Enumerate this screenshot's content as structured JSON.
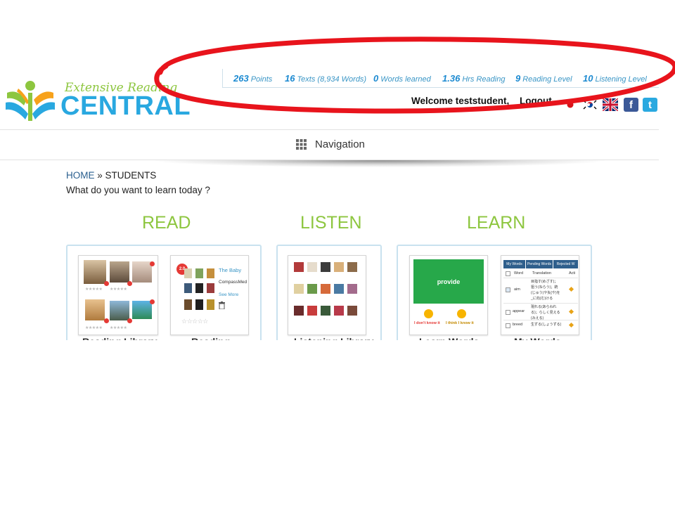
{
  "brand": {
    "script": "Extensive Reading",
    "name": "CENTRAL",
    "colors": {
      "green": "#8dc63f",
      "blue": "#29a8e0"
    }
  },
  "stats": [
    {
      "value": "263",
      "label": "Points"
    },
    {
      "value": "16",
      "label": "Texts (8,934 Words)"
    },
    {
      "value": "0",
      "label": "Words learned"
    },
    {
      "value": "1.36",
      "label": "Hrs Reading"
    },
    {
      "value": "9",
      "label": "Reading Level"
    },
    {
      "value": "10",
      "label": "Listening Level"
    }
  ],
  "user": {
    "welcome": "Welcome teststudent,",
    "logout": "Logout"
  },
  "language_flags": [
    "japan-flag-icon",
    "korea-flag-icon",
    "uk-flag-icon"
  ],
  "social": [
    {
      "icon": "facebook-icon",
      "glyph": "f",
      "color": "#3b5998"
    },
    {
      "icon": "twitter-icon",
      "glyph": "t",
      "color": "#2aa9e0"
    }
  ],
  "nav": {
    "label": "Navigation",
    "icon": "grid-icon"
  },
  "breadcrumb": {
    "home": "HOME",
    "separator": " » ",
    "current": "STUDENTS"
  },
  "question": "What do you want to learn today ?",
  "sections": [
    {
      "title": "READ"
    },
    {
      "title": "LISTEN"
    },
    {
      "title": "LEARN"
    }
  ],
  "read_card_book": {
    "level": "2.0",
    "title": "The Baby",
    "publisher": "CompassMed",
    "more": "See More"
  },
  "flashcard": {
    "word": "provide",
    "no": "I don't know it",
    "think": "I think I know it"
  },
  "word_table": {
    "tabs": [
      "My Words",
      "Pending Words",
      "Rejected W"
    ],
    "headers": [
      "Word",
      "Translation",
      "Acti"
    ],
    "rows": [
      {
        "word": "aim",
        "translation_lines": [
          "目指す(めざす)；",
          "狙う(ねらう)；銃",
          "(じゅう)や矢(や)を",
          "_に向(む)ける"
        ],
        "checked": true
      },
      {
        "word": "appear",
        "translation_lines": [
          "現れる(あらわれ",
          "る)；らしく見える",
          "(みえる)"
        ],
        "checked": false
      },
      {
        "word": "breed",
        "translation_lines": [
          "生ずる(しょうずる)"
        ],
        "checked": false
      }
    ]
  },
  "below_labels": [
    "Reading Library",
    "Reading",
    "Listening Library",
    "Learn Words",
    "My Words"
  ],
  "highlight": {
    "color": "#e8141c"
  }
}
